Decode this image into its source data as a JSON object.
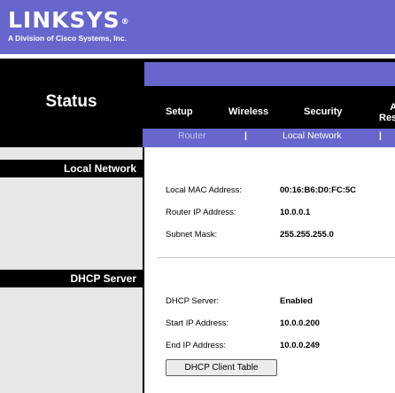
{
  "brand": {
    "logo_text": "LINKSYS",
    "registered_mark": "®",
    "tagline": "A Division of Cisco Systems, Inc."
  },
  "page": {
    "section_title": "Status"
  },
  "nav": {
    "tabs": [
      {
        "label": "Setup"
      },
      {
        "label": "Wireless"
      },
      {
        "label": "Security"
      },
      {
        "label": "A\nRes"
      }
    ],
    "subtabs": [
      {
        "label": "Router",
        "active": false
      },
      {
        "label": "Local Network",
        "active": true
      }
    ],
    "divider": "|"
  },
  "sections": {
    "local_network": {
      "title": "Local Network",
      "rows": [
        {
          "label": "Local MAC Address:",
          "value": "00:16:B6:D0:FC:5C"
        },
        {
          "label": "Router IP Address:",
          "value": "10.0.0.1"
        },
        {
          "label": "Subnet Mask:",
          "value": "255.255.255.0"
        }
      ]
    },
    "dhcp_server": {
      "title": "DHCP Server",
      "rows": [
        {
          "label": "DHCP Server:",
          "value": "Enabled"
        },
        {
          "label": "Start IP Address:",
          "value": "10.0.0.200"
        },
        {
          "label": "End IP Address:",
          "value": "10.0.0.249"
        }
      ],
      "button_label": "DHCP Client Table"
    }
  },
  "colors": {
    "brand_purple": "#6666cc",
    "sidebar_gray": "#e7e7e7",
    "header_black": "#000000"
  }
}
